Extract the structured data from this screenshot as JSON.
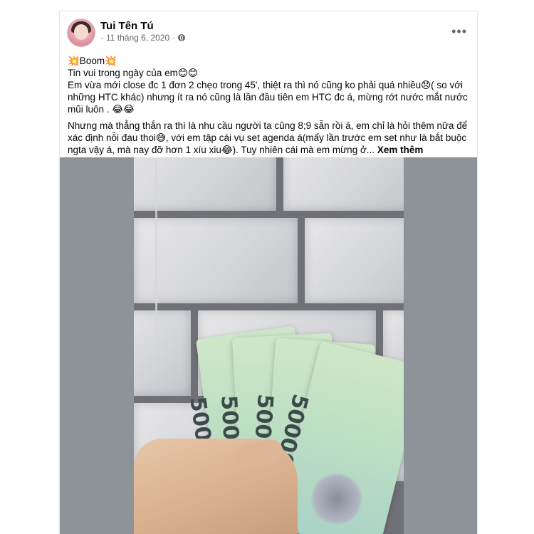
{
  "post": {
    "author": "Tui Tên Tú",
    "date": "11 tháng 6, 2020",
    "separator": "·",
    "more_label": "•••",
    "lines": [
      "💥Boom💥",
      "Tin vui trong ngày của em😊😊",
      "Em vừa mới close đc 1 đơn 2 chẹo trong 45', thiệt ra thì nó cũng ko phải quá nhiều😞( so với những HTC khác) nhưng ít ra nó cũng là lần đầu tiên em HTC đc á, mừng rớt nước mắt nước mũi luôn . 😂😂",
      "Nhưng mà thẳng thắn ra thì là nhu cầu người ta cũng 8;9 sẵn rồi á, em chỉ là hỏi thêm nữa để xác định nỗi đau thoi😅, với em tập cái vụ set agenda á(mấy lần trước em set như là bắt buộc ngta vậy á, mà nay đỡ hơn 1 xíu xiu😂). Tuy nhiên cái mà em mừng ở..."
    ],
    "see_more": "Xem thêm"
  },
  "photo": {
    "banknote_amount": "500000",
    "colors": {
      "background": "#8d9398",
      "note": "#bfe0c4",
      "wall": "#dcdde0"
    }
  },
  "icons": {
    "privacy": "globe-icon",
    "menu": "more-icon"
  }
}
